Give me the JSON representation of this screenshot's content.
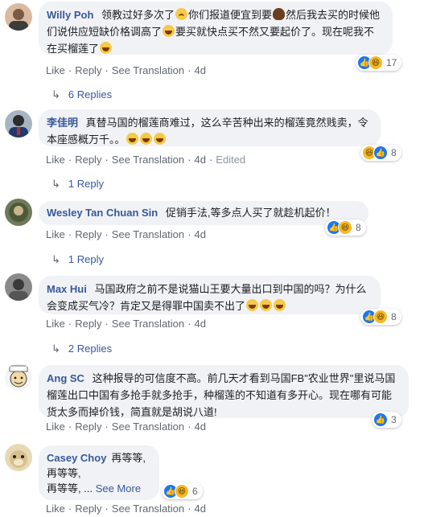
{
  "action_labels": {
    "like": "Like",
    "reply": "Reply",
    "see_translation": "See Translation",
    "edited": "Edited"
  },
  "comments": [
    {
      "author": "Willy Poh",
      "text_parts": [
        "领教过好多次了",
        "你们报道便宜到要",
        "然后我去买的时候他们说供应短缺价格调高了",
        "要买就快点买不然又要起价了。现在呢我不在买榴莲了"
      ],
      "time": "4d",
      "reactions": [
        "like",
        "haha"
      ],
      "reaction_count": "17",
      "replies": "6 Replies"
    },
    {
      "author": "李佳明",
      "text": "真替马国的榴莲商难过，这么辛苦种出来的榴莲竟然贱卖，令本座感概万千。。",
      "time": "4d",
      "edited": true,
      "reactions": [
        "haha",
        "like"
      ],
      "reaction_count": "8",
      "replies": "1 Reply"
    },
    {
      "author": "Wesley Tan Chuan Sin",
      "text": "促销手法,等多点人买了就趁机起价！",
      "time": "4d",
      "reactions": [
        "like",
        "haha"
      ],
      "reaction_count": "8",
      "replies": "1 Reply"
    },
    {
      "author": "Max Hui",
      "text": "马国政府之前不是说猫山王要大量出口到中国的吗？为什么会变成买气冷？肯定又是得罪中国卖不出了",
      "time": "4d",
      "reactions": [
        "like",
        "haha"
      ],
      "reaction_count": "8",
      "replies": "2 Replies"
    },
    {
      "author": "Ang SC",
      "text": "这种报导的可信度不高。前几天才看到马国FB\"农业世界\"里说马国榴莲出口中国有多抢手就多抢手，种榴莲的不知道有多开心。现在哪有可能货太多而掉价钱，简直就是胡说八道!",
      "time": "4d",
      "reactions": [
        "like"
      ],
      "reaction_count": "3"
    },
    {
      "author": "Casey Choy",
      "text_lines": [
        "再等等,",
        "再等等,",
        "再等等, ..."
      ],
      "see_more": "See More",
      "time": "4d",
      "reactions": [
        "like",
        "haha"
      ],
      "reaction_count": "6"
    }
  ]
}
